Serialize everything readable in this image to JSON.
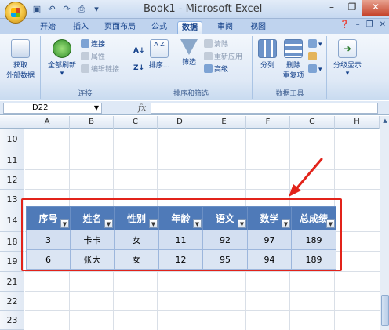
{
  "window": {
    "title": "Book1 - Microsoft Excel"
  },
  "quick_access": [
    "save-icon",
    "undo-icon",
    "redo-icon",
    "print-preview-icon"
  ],
  "tabs": [
    "开始",
    "插入",
    "页面布局",
    "公式",
    "数据",
    "审阅",
    "视图"
  ],
  "active_tab": "数据",
  "ribbon": {
    "get_external": {
      "label_line1": "获取",
      "label_line2": "外部数据"
    },
    "refresh_all": {
      "label": "全部刷新"
    },
    "connections": {
      "connect": "连接",
      "properties": "属性",
      "edit_links": "编辑链接",
      "group_label": "连接"
    },
    "sort": {
      "sort_btn": "排序...",
      "filter": "筛选",
      "clear": "清除",
      "reapply": "重新应用",
      "advanced": "高级",
      "group_label": "排序和筛选"
    },
    "tools": {
      "text_to_columns": "分列",
      "remove_dup_line1": "删除",
      "remove_dup_line2": "重复项",
      "group_label": "数据工具"
    },
    "outline": {
      "label": "分级显示"
    }
  },
  "name_box": "D22",
  "formula_fx": "fx",
  "columns": [
    "A",
    "B",
    "C",
    "D",
    "E",
    "F",
    "G",
    "H"
  ],
  "rows": [
    "10",
    "11",
    "12",
    "13",
    "14",
    "18",
    "19",
    "21",
    "22",
    "23"
  ],
  "table": {
    "headers": [
      "序号",
      "姓名",
      "性别",
      "年龄",
      "语文",
      "数学",
      "总成绩"
    ],
    "rows": [
      [
        "3",
        "卡卡",
        "女",
        "11",
        "92",
        "97",
        "189"
      ],
      [
        "6",
        "张大",
        "女",
        "12",
        "95",
        "94",
        "189"
      ]
    ]
  },
  "colors": {
    "header_fill": "#4f7ab8",
    "row_fill": "#d3dff1",
    "annotation": "#e2231a"
  }
}
